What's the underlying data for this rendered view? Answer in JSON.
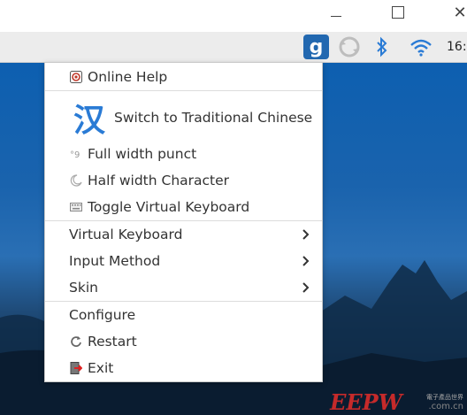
{
  "titlebar": {
    "minimize_icon": "minimize-icon",
    "maximize_icon": "maximize-icon",
    "close_icon": "close-icon",
    "close_glyph": "✕"
  },
  "panel": {
    "fcitx_glyph": "g",
    "clock": "16:",
    "colors": {
      "fcitx_bg": "#2268b0",
      "accent": "#2a7bd5"
    }
  },
  "menu": {
    "online_help": "Online Help",
    "switch_chinese": "Switch to Traditional Chinese",
    "switch_glyph": "汉",
    "full_width_punct": "Full width punct",
    "half_width_char": "Half width Character",
    "toggle_vk": "Toggle Virtual Keyboard",
    "virtual_keyboard": "Virtual Keyboard",
    "input_method": "Input Method",
    "skin": "Skin",
    "configure": "Configure",
    "restart": "Restart",
    "exit": "Exit"
  },
  "watermark": {
    "logo": "EEPW",
    "cn": "電子產品世界",
    "url": ".com.cn"
  }
}
